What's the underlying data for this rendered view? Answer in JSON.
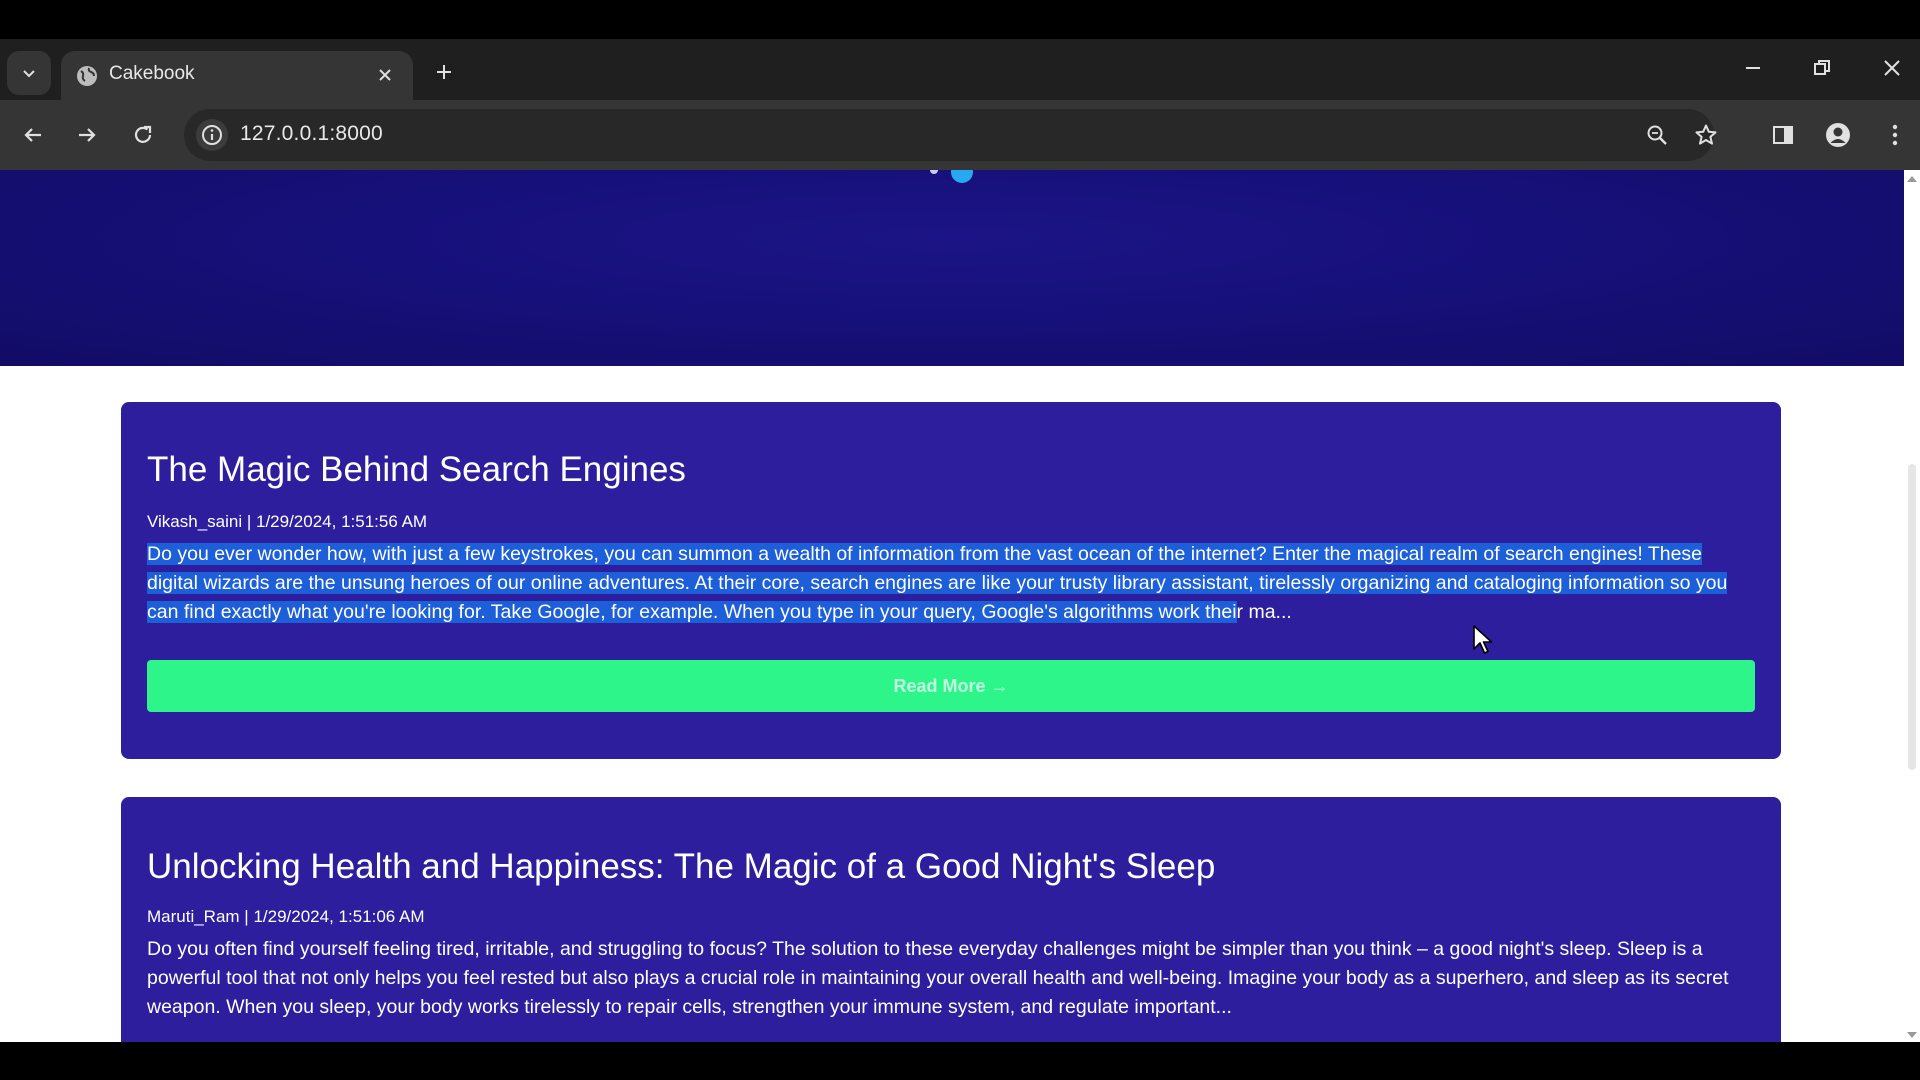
{
  "browser": {
    "tab_title": "Cakebook",
    "url": "127.0.0.1:8000"
  },
  "icons": {
    "tab_list": "chevron-down-icon",
    "favicon": "globe-icon",
    "tab_close": "close-icon",
    "new_tab": "plus-icon",
    "minimize": "minimize-icon",
    "restore": "restore-icon",
    "close_window": "close-icon",
    "back": "arrow-left-icon",
    "forward": "arrow-right-icon",
    "reload": "reload-icon",
    "site_info": "info-icon",
    "zoom": "zoom-icon",
    "bookmark": "star-icon",
    "side_panel": "side-panel-icon",
    "profile": "profile-icon",
    "menu": "kebab-menu-icon",
    "cursor": "mouse-pointer-icon"
  },
  "posts": [
    {
      "title": "The Magic Behind Search Engines",
      "meta": "Vikash_saini | 1/29/2024, 1:51:56 AM",
      "excerpt_highlighted": "Do you ever wonder how, with just a few keystrokes, you can summon a wealth of information from the vast ocean of the internet? Enter the magical realm of search engines! These digital wizards are the unsung heroes of our online adventures. At their core, search engines are like your trusty library assistant, tirelessly organizing and cataloging information so you can find exactly what you're looking for. Take Google, for example. When you type in your query, Google's algorithms work thei",
      "excerpt_rest": "r ma...",
      "button_label": "Read More →"
    },
    {
      "title": "Unlocking Health and Happiness: The Magic of a Good Night's Sleep",
      "meta": "Maruti_Ram | 1/29/2024, 1:51:06 AM",
      "excerpt": "Do you often find yourself feeling tired, irritable, and struggling to focus? The solution to these everyday challenges might be simpler than you think – a good night's sleep. Sleep is a powerful tool that not only helps you feel rested but also plays a crucial role in maintaining your overall health and well-being. Imagine your body as a superhero, and sleep as its secret weapon. When you sleep, your body works tirelessly to repair cells, strengthen your immune system, and regulate important..."
    }
  ],
  "colors": {
    "hero_bg": "#16107a",
    "card_bg": "#2d1e9e",
    "button_bg": "#2ef58a",
    "selection": "#1d5ed9"
  }
}
